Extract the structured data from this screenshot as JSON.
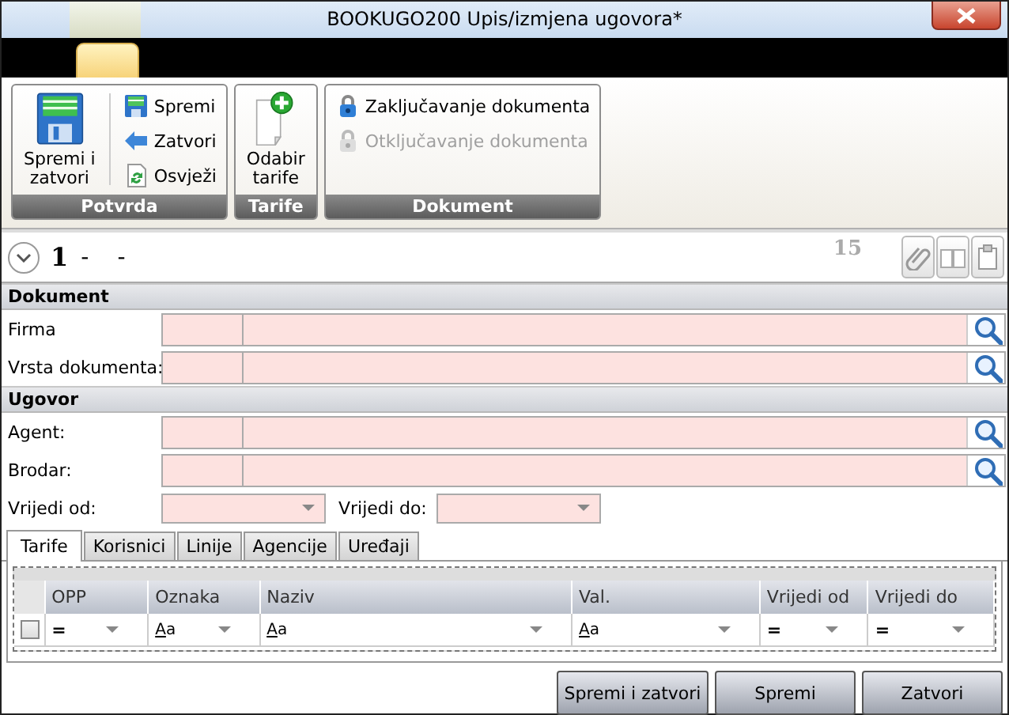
{
  "window": {
    "title": "BOOKUGO200  Upis/izmjena ugovora*"
  },
  "ribbon": {
    "groups": [
      {
        "label": "Potvrda",
        "items": [
          {
            "label": "Spremi i zatvori",
            "kind": "large",
            "disabled": false
          },
          {
            "label": "Spremi",
            "kind": "small",
            "disabled": false
          },
          {
            "label": "Zatvori",
            "kind": "small",
            "disabled": false
          },
          {
            "label": "Osvježi",
            "kind": "small",
            "disabled": false
          }
        ]
      },
      {
        "label": "Tarife",
        "items": [
          {
            "label": "Odabir tarife",
            "kind": "large",
            "disabled": false
          }
        ]
      },
      {
        "label": "Dokument",
        "items": [
          {
            "label": "Zaključavanje dokumenta",
            "kind": "small",
            "disabled": false
          },
          {
            "label": "Otključavanje dokumenta",
            "kind": "small",
            "disabled": true
          }
        ]
      }
    ]
  },
  "header": {
    "number": "1",
    "separators": [
      "-",
      "-"
    ],
    "count": "15"
  },
  "sections": [
    {
      "title": "Dokument",
      "rows": [
        {
          "kind": "lookup",
          "label": "Firma"
        },
        {
          "kind": "lookup",
          "label": "Vrsta dokumenta:"
        }
      ]
    },
    {
      "title": "Ugovor",
      "rows": [
        {
          "kind": "lookup",
          "label": "Agent:"
        },
        {
          "kind": "lookup",
          "label": "Brodar:"
        },
        {
          "kind": "pair",
          "fields": [
            {
              "label": "Vrijedi od:"
            },
            {
              "label": "Vrijedi do:"
            }
          ]
        }
      ]
    }
  ],
  "tabs": [
    {
      "label": "Tarife",
      "selected": true
    },
    {
      "label": "Korisnici",
      "selected": false
    },
    {
      "label": "Linije",
      "selected": false
    },
    {
      "label": "Agencije",
      "selected": false
    },
    {
      "label": "Uređaji",
      "selected": false
    }
  ],
  "grid": {
    "checked": false,
    "columns": [
      {
        "header": "OPP",
        "filter": "="
      },
      {
        "header": "Oznaka",
        "filter": "Aa"
      },
      {
        "header": "Naziv",
        "filter": "Aa"
      },
      {
        "header": "Val.",
        "filter": "Aa"
      },
      {
        "header": "Vrijedi od",
        "filter": "="
      },
      {
        "header": "Vrijedi do",
        "filter": "="
      }
    ]
  },
  "buttons": [
    "Spremi i zatvori",
    "Spremi",
    "Zatvori"
  ]
}
